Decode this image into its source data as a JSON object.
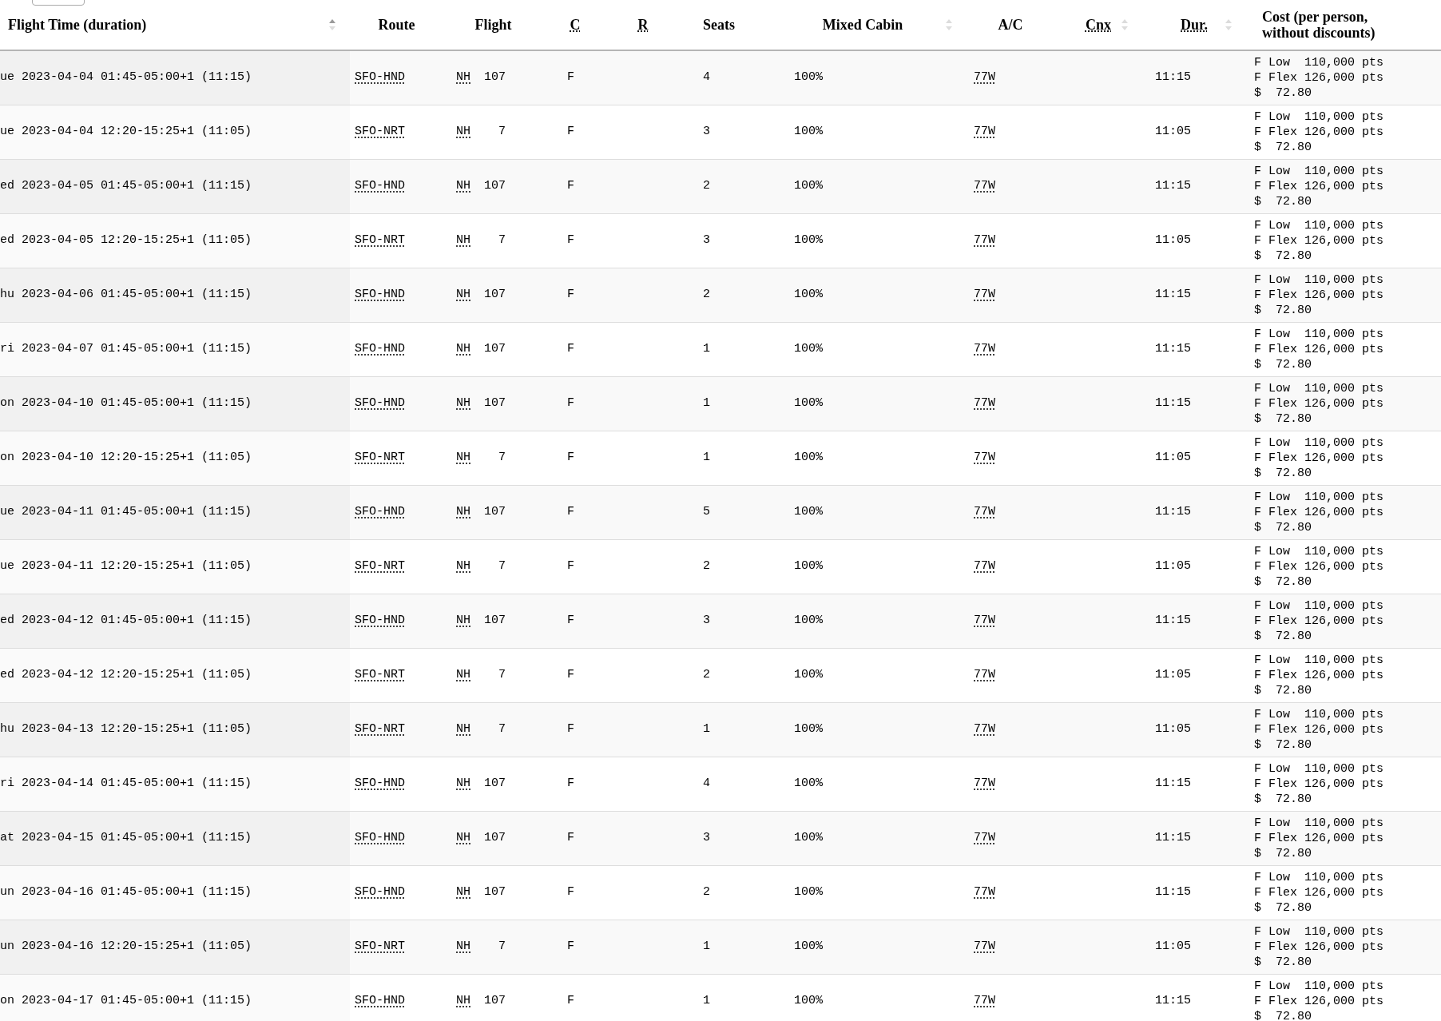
{
  "columns": [
    {
      "label": "Flight Time (duration)",
      "abbr": false,
      "sortable": true,
      "sorted": true
    },
    {
      "label": "Route",
      "abbr": false,
      "sortable": false
    },
    {
      "label": "Flight",
      "abbr": false,
      "sortable": false
    },
    {
      "label": "C",
      "abbr": true,
      "sortable": false
    },
    {
      "label": "R",
      "abbr": true,
      "sortable": false
    },
    {
      "label": "Seats",
      "abbr": false,
      "sortable": false
    },
    {
      "label": "Mixed Cabin",
      "abbr": false,
      "sortable": true,
      "sorted": false
    },
    {
      "label": "A/C",
      "abbr": false,
      "sortable": false
    },
    {
      "label": "Cnx",
      "abbr": true,
      "sortable": true,
      "sorted": false
    },
    {
      "label": "Dur.",
      "abbr": true,
      "sortable": true,
      "sorted": false
    },
    {
      "label": "Cost (per person, without discounts)",
      "abbr": false,
      "sortable": false
    }
  ],
  "rows": [
    {
      "time": "ue 2023-04-04 01:45-05:00+1 (11:15)",
      "route": "SFO-HND",
      "airline": "NH",
      "flight": "107",
      "cabin": "F",
      "seats": "4",
      "mixed": "100%",
      "aircraft": "77W",
      "duration": "11:15",
      "cost": [
        "F Low  110,000 pts",
        "F Flex 126,000 pts",
        "$  72.80"
      ]
    },
    {
      "time": "ue 2023-04-04 12:20-15:25+1 (11:05)",
      "route": "SFO-NRT",
      "airline": "NH",
      "flight": "7",
      "cabin": "F",
      "seats": "3",
      "mixed": "100%",
      "aircraft": "77W",
      "duration": "11:05",
      "cost": [
        "F Low  110,000 pts",
        "F Flex 126,000 pts",
        "$  72.80"
      ]
    },
    {
      "time": "ed 2023-04-05 01:45-05:00+1 (11:15)",
      "route": "SFO-HND",
      "airline": "NH",
      "flight": "107",
      "cabin": "F",
      "seats": "2",
      "mixed": "100%",
      "aircraft": "77W",
      "duration": "11:15",
      "cost": [
        "F Low  110,000 pts",
        "F Flex 126,000 pts",
        "$  72.80"
      ]
    },
    {
      "time": "ed 2023-04-05 12:20-15:25+1 (11:05)",
      "route": "SFO-NRT",
      "airline": "NH",
      "flight": "7",
      "cabin": "F",
      "seats": "3",
      "mixed": "100%",
      "aircraft": "77W",
      "duration": "11:05",
      "cost": [
        "F Low  110,000 pts",
        "F Flex 126,000 pts",
        "$  72.80"
      ]
    },
    {
      "time": "hu 2023-04-06 01:45-05:00+1 (11:15)",
      "route": "SFO-HND",
      "airline": "NH",
      "flight": "107",
      "cabin": "F",
      "seats": "2",
      "mixed": "100%",
      "aircraft": "77W",
      "duration": "11:15",
      "cost": [
        "F Low  110,000 pts",
        "F Flex 126,000 pts",
        "$  72.80"
      ]
    },
    {
      "time": "ri 2023-04-07 01:45-05:00+1 (11:15)",
      "route": "SFO-HND",
      "airline": "NH",
      "flight": "107",
      "cabin": "F",
      "seats": "1",
      "mixed": "100%",
      "aircraft": "77W",
      "duration": "11:15",
      "cost": [
        "F Low  110,000 pts",
        "F Flex 126,000 pts",
        "$  72.80"
      ]
    },
    {
      "time": "on 2023-04-10 01:45-05:00+1 (11:15)",
      "route": "SFO-HND",
      "airline": "NH",
      "flight": "107",
      "cabin": "F",
      "seats": "1",
      "mixed": "100%",
      "aircraft": "77W",
      "duration": "11:15",
      "cost": [
        "F Low  110,000 pts",
        "F Flex 126,000 pts",
        "$  72.80"
      ]
    },
    {
      "time": "on 2023-04-10 12:20-15:25+1 (11:05)",
      "route": "SFO-NRT",
      "airline": "NH",
      "flight": "7",
      "cabin": "F",
      "seats": "1",
      "mixed": "100%",
      "aircraft": "77W",
      "duration": "11:05",
      "cost": [
        "F Low  110,000 pts",
        "F Flex 126,000 pts",
        "$  72.80"
      ]
    },
    {
      "time": "ue 2023-04-11 01:45-05:00+1 (11:15)",
      "route": "SFO-HND",
      "airline": "NH",
      "flight": "107",
      "cabin": "F",
      "seats": "5",
      "mixed": "100%",
      "aircraft": "77W",
      "duration": "11:15",
      "cost": [
        "F Low  110,000 pts",
        "F Flex 126,000 pts",
        "$  72.80"
      ]
    },
    {
      "time": "ue 2023-04-11 12:20-15:25+1 (11:05)",
      "route": "SFO-NRT",
      "airline": "NH",
      "flight": "7",
      "cabin": "F",
      "seats": "2",
      "mixed": "100%",
      "aircraft": "77W",
      "duration": "11:05",
      "cost": [
        "F Low  110,000 pts",
        "F Flex 126,000 pts",
        "$  72.80"
      ]
    },
    {
      "time": "ed 2023-04-12 01:45-05:00+1 (11:15)",
      "route": "SFO-HND",
      "airline": "NH",
      "flight": "107",
      "cabin": "F",
      "seats": "3",
      "mixed": "100%",
      "aircraft": "77W",
      "duration": "11:15",
      "cost": [
        "F Low  110,000 pts",
        "F Flex 126,000 pts",
        "$  72.80"
      ]
    },
    {
      "time": "ed 2023-04-12 12:20-15:25+1 (11:05)",
      "route": "SFO-NRT",
      "airline": "NH",
      "flight": "7",
      "cabin": "F",
      "seats": "2",
      "mixed": "100%",
      "aircraft": "77W",
      "duration": "11:05",
      "cost": [
        "F Low  110,000 pts",
        "F Flex 126,000 pts",
        "$  72.80"
      ]
    },
    {
      "time": "hu 2023-04-13 12:20-15:25+1 (11:05)",
      "route": "SFO-NRT",
      "airline": "NH",
      "flight": "7",
      "cabin": "F",
      "seats": "1",
      "mixed": "100%",
      "aircraft": "77W",
      "duration": "11:05",
      "cost": [
        "F Low  110,000 pts",
        "F Flex 126,000 pts",
        "$  72.80"
      ]
    },
    {
      "time": "ri 2023-04-14 01:45-05:00+1 (11:15)",
      "route": "SFO-HND",
      "airline": "NH",
      "flight": "107",
      "cabin": "F",
      "seats": "4",
      "mixed": "100%",
      "aircraft": "77W",
      "duration": "11:15",
      "cost": [
        "F Low  110,000 pts",
        "F Flex 126,000 pts",
        "$  72.80"
      ]
    },
    {
      "time": "at 2023-04-15 01:45-05:00+1 (11:15)",
      "route": "SFO-HND",
      "airline": "NH",
      "flight": "107",
      "cabin": "F",
      "seats": "3",
      "mixed": "100%",
      "aircraft": "77W",
      "duration": "11:15",
      "cost": [
        "F Low  110,000 pts",
        "F Flex 126,000 pts",
        "$  72.80"
      ]
    },
    {
      "time": "un 2023-04-16 01:45-05:00+1 (11:15)",
      "route": "SFO-HND",
      "airline": "NH",
      "flight": "107",
      "cabin": "F",
      "seats": "2",
      "mixed": "100%",
      "aircraft": "77W",
      "duration": "11:15",
      "cost": [
        "F Low  110,000 pts",
        "F Flex 126,000 pts",
        "$  72.80"
      ]
    },
    {
      "time": "un 2023-04-16 12:20-15:25+1 (11:05)",
      "route": "SFO-NRT",
      "airline": "NH",
      "flight": "7",
      "cabin": "F",
      "seats": "1",
      "mixed": "100%",
      "aircraft": "77W",
      "duration": "11:05",
      "cost": [
        "F Low  110,000 pts",
        "F Flex 126,000 pts",
        "$  72.80"
      ]
    },
    {
      "time": "on 2023-04-17 01:45-05:00+1 (11:15)",
      "route": "SFO-HND",
      "airline": "NH",
      "flight": "107",
      "cabin": "F",
      "seats": "1",
      "mixed": "100%",
      "aircraft": "77W",
      "duration": "11:15",
      "cost": [
        "F Low  110,000 pts",
        "F Flex 126,000 pts",
        "$  72.80"
      ]
    }
  ]
}
